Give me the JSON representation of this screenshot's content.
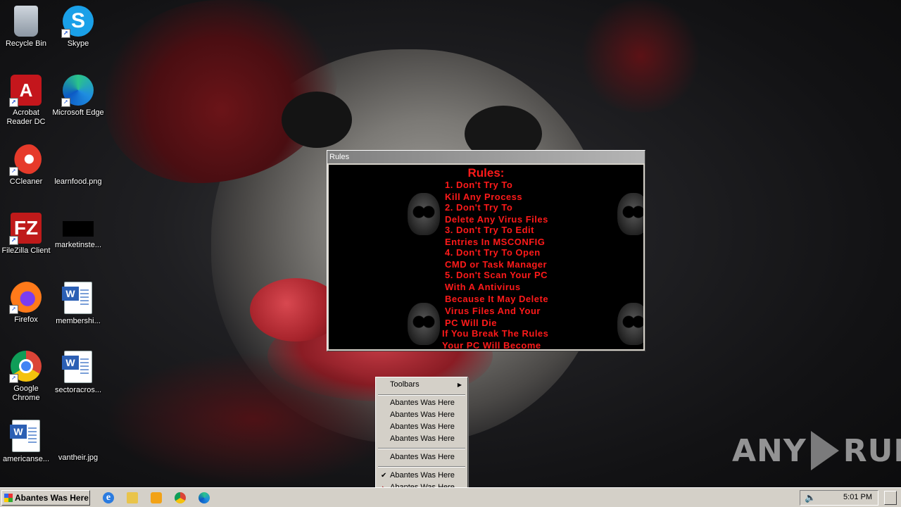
{
  "desktop": {
    "icons": [
      {
        "label": "Recycle Bin",
        "icon": "recycle-bin-icon"
      },
      {
        "label": "Skype",
        "icon": "skype-icon"
      },
      {
        "label": "Acrobat Reader DC",
        "icon": "acrobat-icon"
      },
      {
        "label": "Microsoft Edge",
        "icon": "edge-icon"
      },
      {
        "label": "CCleaner",
        "icon": "ccleaner-icon"
      },
      {
        "label": "learnfood.png",
        "icon": "image-file-icon"
      },
      {
        "label": "FileZilla Client",
        "icon": "filezilla-icon"
      },
      {
        "label": "marketinste...",
        "icon": "image-file-icon"
      },
      {
        "label": "Firefox",
        "icon": "firefox-icon"
      },
      {
        "label": "membershi...",
        "icon": "word-doc-icon"
      },
      {
        "label": "Google Chrome",
        "icon": "chrome-icon"
      },
      {
        "label": "sectoracros...",
        "icon": "word-doc-icon"
      },
      {
        "label": "americanse...",
        "icon": "word-doc-icon"
      },
      {
        "label": "vantheir.jpg",
        "icon": "image-file-icon"
      }
    ]
  },
  "rules_window": {
    "title": "Rules",
    "heading": "Rules:",
    "lines": [
      "1. Don't Try To",
      "Kill Any Process",
      "2. Don't Try To",
      "Delete Any Virus Files",
      "3. Don't Try To Edit",
      "Entries In MSCONFIG",
      "4. Don't Try To Open",
      "CMD or Task Manager",
      "5. Don't Scan Your PC",
      "With A Antivirus",
      "Because It May Delete",
      "Virus Files And Your",
      "PC Will Die",
      "If You Break The Rules",
      "Your PC Will Become"
    ],
    "text_color": "#ff1a1a"
  },
  "context_menu": {
    "toolbars": "Toolbars",
    "group1": [
      "Abantes Was Here",
      "Abantes Was Here",
      "Abantes Was Here",
      "Abantes Was Here"
    ],
    "group2": [
      "Abantes Was Here"
    ],
    "group3": [
      "Abantes Was Here",
      "Abantes Was Here"
    ],
    "checked_item": "Abantes Was Here"
  },
  "taskbar": {
    "start_label": "Abantes Was Here",
    "quick_launch": [
      "internet-explorer-icon",
      "explorer-icon",
      "media-player-icon",
      "chrome-icon",
      "edge-icon"
    ],
    "clock": "5:01 PM"
  },
  "watermark": {
    "left": "ANY",
    "right": "RUN"
  }
}
